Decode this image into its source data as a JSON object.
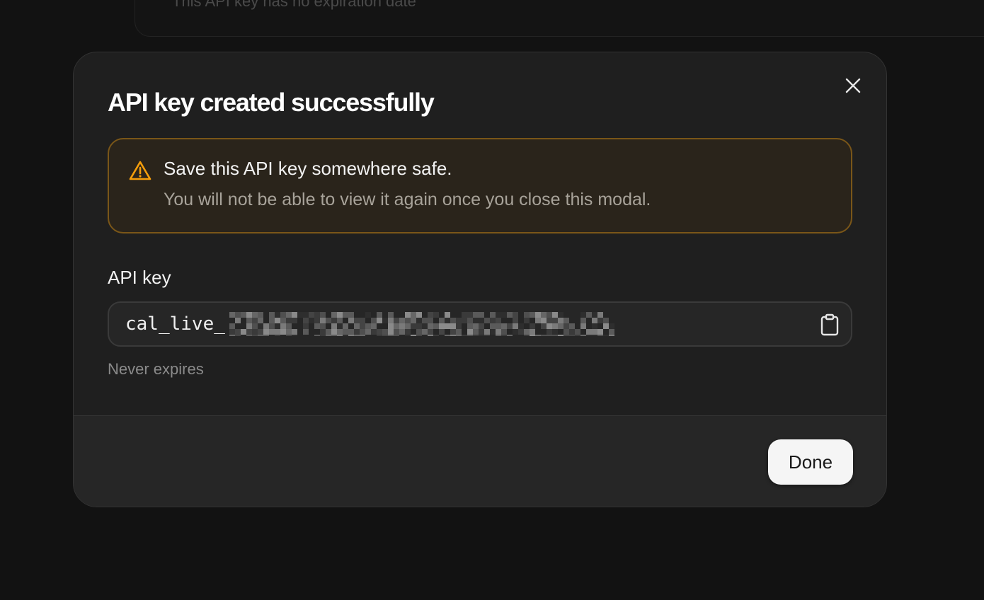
{
  "background": {
    "card_text": "This API key has no expiration date"
  },
  "modal": {
    "title": "API key created successfully",
    "close_icon": "close-icon",
    "warning": {
      "icon": "warning-triangle-icon",
      "title": "Save this API key somewhere safe.",
      "text": "You will not be able to view it again once you close this modal.",
      "accent_color": "#f59e0b"
    },
    "field_label": "API key",
    "api_key_value": "cal_live_",
    "copy_icon": "clipboard-icon",
    "expiry_text": "Never expires",
    "done_label": "Done"
  }
}
